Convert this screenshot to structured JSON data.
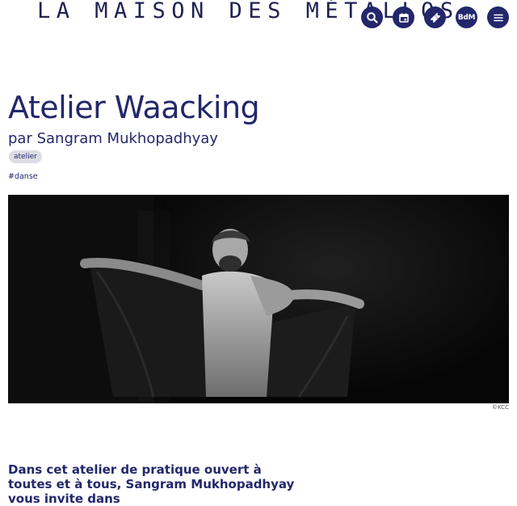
{
  "header": {
    "site_title": "LA MAISON DES MÉTALLOS",
    "icons": [
      "search-icon",
      "calendar-icon",
      "ticket-icon",
      "bdm-icon",
      "menu-icon"
    ],
    "bdm_label": "BdM"
  },
  "event": {
    "title": "Atelier Waacking",
    "subtitle": "par Sangram Mukhopadhyay",
    "tag": "atelier",
    "hashtag": "#danse",
    "photo_credit": "©KCC",
    "intro": "Dans cet atelier de pratique ouvert à toutes et à tous, Sangram Mukhopadhyay vous invite dans"
  },
  "colors": {
    "brand": "#23276b",
    "tag_bg": "#dcdde4",
    "background": "#ffffff"
  }
}
